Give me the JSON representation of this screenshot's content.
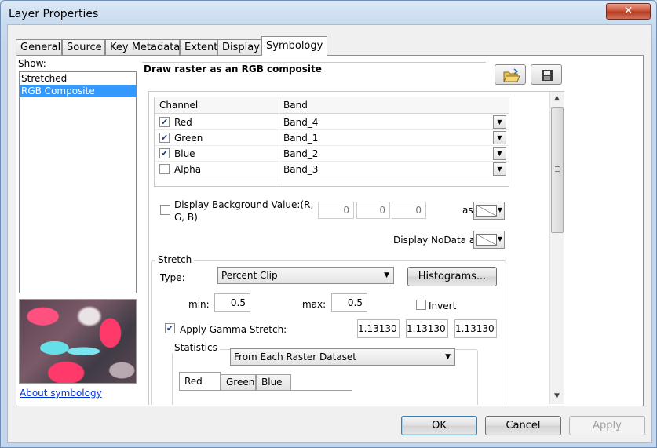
{
  "window": {
    "title": "Layer Properties",
    "close_glyph": "✕"
  },
  "tabs": [
    "General",
    "Source",
    "Key Metadata",
    "Extent",
    "Display",
    "Symbology"
  ],
  "active_tab": "Symbology",
  "show": {
    "label": "Show:",
    "items": [
      "Stretched",
      "RGB Composite"
    ],
    "selected": "RGB Composite",
    "about_link": "About symbology"
  },
  "renderer": {
    "heading": "Draw raster as an RGB composite",
    "open_icon": "open-folder-icon",
    "save_icon": "save-disk-icon"
  },
  "channel_table": {
    "headers": {
      "channel": "Channel",
      "band": "Band"
    },
    "rows": [
      {
        "channel": "Red",
        "band": "Band_4",
        "checked": true
      },
      {
        "channel": "Green",
        "band": "Band_1",
        "checked": true
      },
      {
        "channel": "Blue",
        "band": "Band_2",
        "checked": true
      },
      {
        "channel": "Alpha",
        "band": "Band_3",
        "checked": false
      }
    ]
  },
  "background": {
    "label": "Display Background Value:(R, G, B)",
    "checked": false,
    "values": [
      "0",
      "0",
      "0"
    ],
    "as_label": "as"
  },
  "nodata": {
    "label": "Display NoData as"
  },
  "stretch": {
    "group_label": "Stretch",
    "type_label": "Type:",
    "type_value": "Percent Clip",
    "histograms_button": "Histograms...",
    "min_label": "min:",
    "min_value": "0.5",
    "max_label": "max:",
    "max_value": "0.5",
    "invert_label": "Invert",
    "invert_checked": false,
    "gamma_label": "Apply Gamma Stretch:",
    "gamma_checked": true,
    "gamma_values": [
      "1.13130",
      "1.13130",
      "1.13130"
    ]
  },
  "statistics": {
    "group_label": "Statistics",
    "source_value": "From Each Raster Dataset",
    "tabs": [
      "Red",
      "Green",
      "Blue"
    ],
    "active_tab": "Red"
  },
  "footer": {
    "ok": "OK",
    "cancel": "Cancel",
    "apply": "Apply"
  }
}
